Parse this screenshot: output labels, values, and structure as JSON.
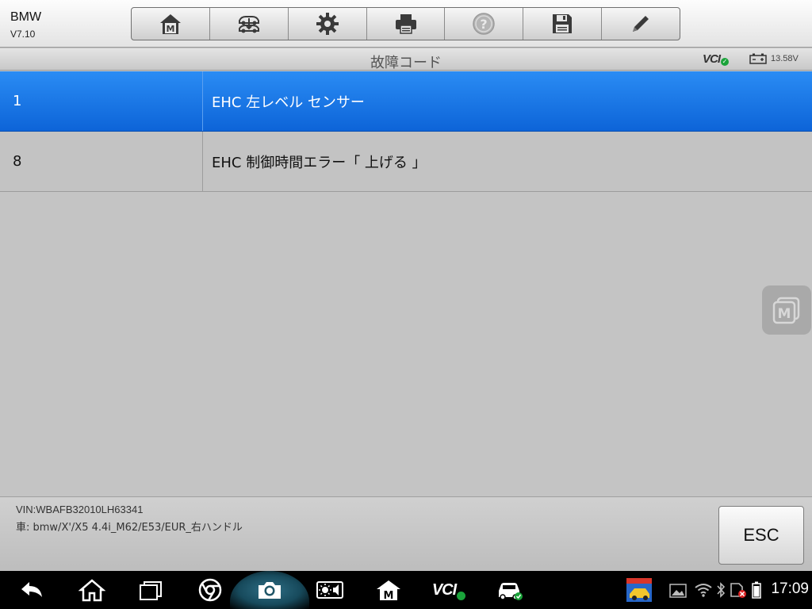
{
  "app": {
    "name": "BMW",
    "version": "V7.10"
  },
  "toolbar": {
    "buttons": [
      {
        "icon": "home-m-icon"
      },
      {
        "icon": "vehicle-swap-icon"
      },
      {
        "icon": "gear-icon"
      },
      {
        "icon": "printer-icon"
      },
      {
        "icon": "help-icon"
      },
      {
        "icon": "save-icon"
      },
      {
        "icon": "pencil-icon"
      }
    ]
  },
  "header": {
    "title": "故障コード",
    "vci_label": "VCI",
    "battery_voltage": "13.58V"
  },
  "dtc_list": [
    {
      "code": "1",
      "description": "EHC 左レベル センサー",
      "selected": true
    },
    {
      "code": "8",
      "description": "EHC 制御時間エラー「 上げる 」",
      "selected": false
    }
  ],
  "footer": {
    "vin": "VIN:WBAFB32010LH63341",
    "vehicle": "車: bmw/X'/X5 4.4i_M62/E53/EUR_右ハンドル",
    "esc_label": "ESC"
  },
  "navbar": {
    "vci_label": "VCI",
    "clock": "17:09"
  },
  "colors": {
    "selected_row": "#1a76e6",
    "background": "#c4c4c4",
    "status_ok": "#1aa33a"
  }
}
